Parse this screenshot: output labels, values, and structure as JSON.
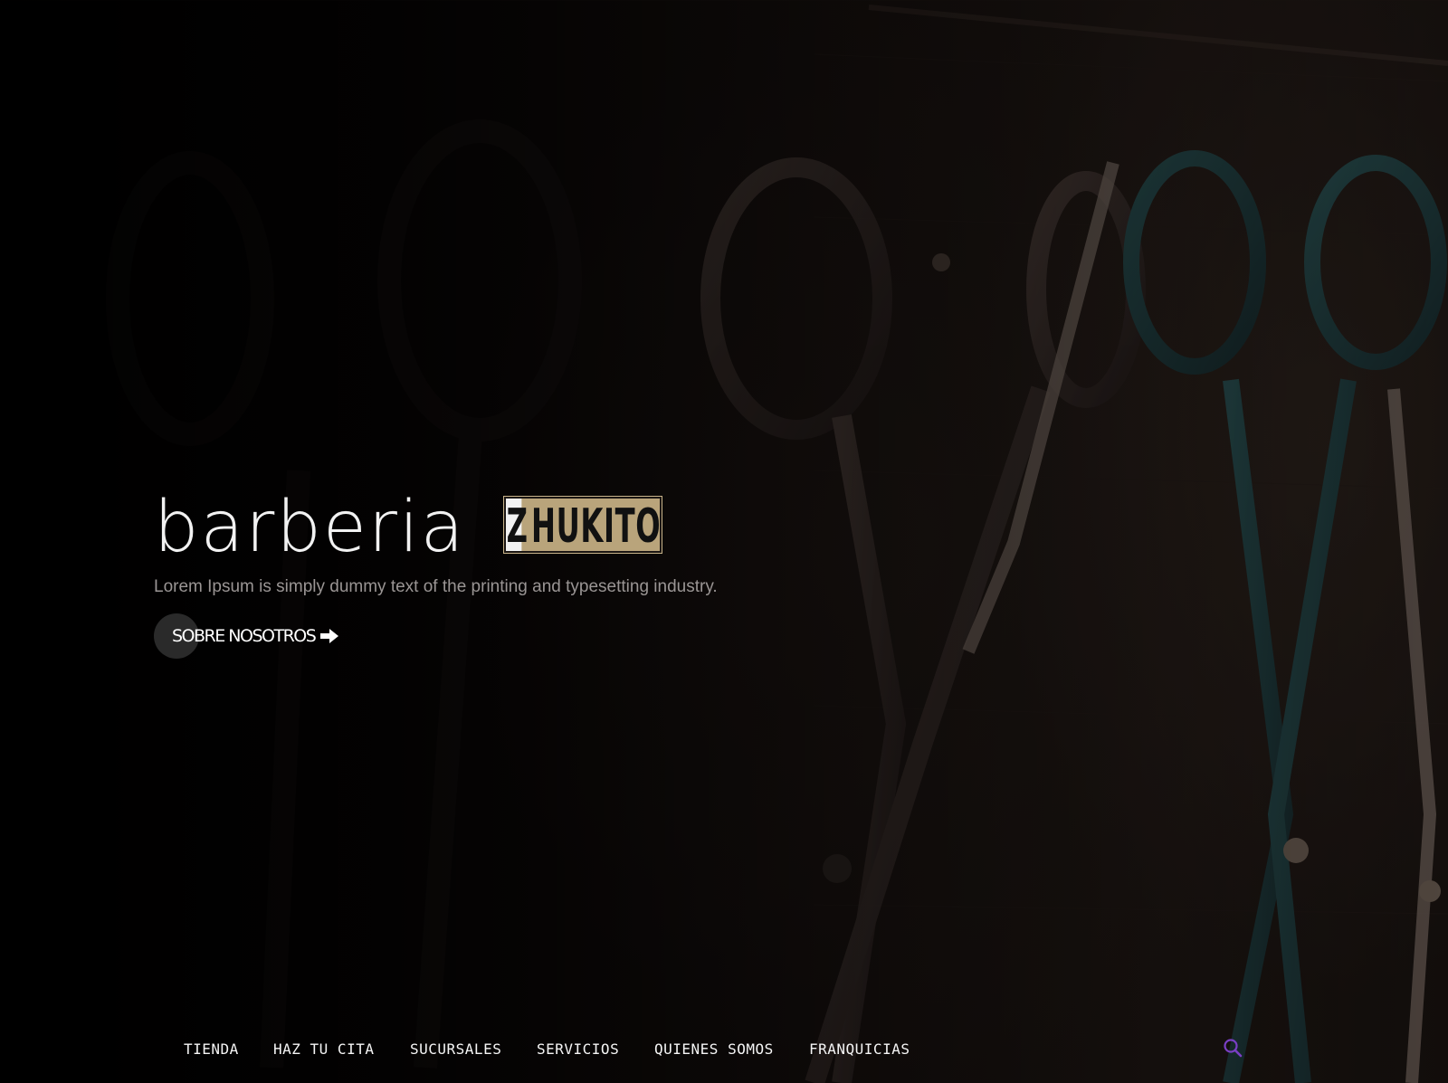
{
  "hero": {
    "title": "barberia",
    "brand_first": "Z",
    "brand_rest": "HUKITO",
    "subtitle": "Lorem Ipsum is simply dummy text of the printing and typesetting industry.",
    "cta_label": "SOBRE NOSOTROS",
    "cta_icon": "arrow-right-icon",
    "background_image": "scissors-hanging-on-wall"
  },
  "nav": {
    "items": [
      {
        "label": "TIENDA"
      },
      {
        "label": "HAZ TU CITA"
      },
      {
        "label": "SUCURSALES"
      },
      {
        "label": "SERVICIOS"
      },
      {
        "label": "QUIENES SOMOS"
      },
      {
        "label": "FRANQUICIAS"
      }
    ],
    "search_icon": "search-icon"
  },
  "colors": {
    "brand_gold": "#b9a47b",
    "text_white": "#ffffff",
    "subtitle_gray": "#9a9594",
    "search_purple": "#7a3fc4",
    "background": "#050303"
  }
}
